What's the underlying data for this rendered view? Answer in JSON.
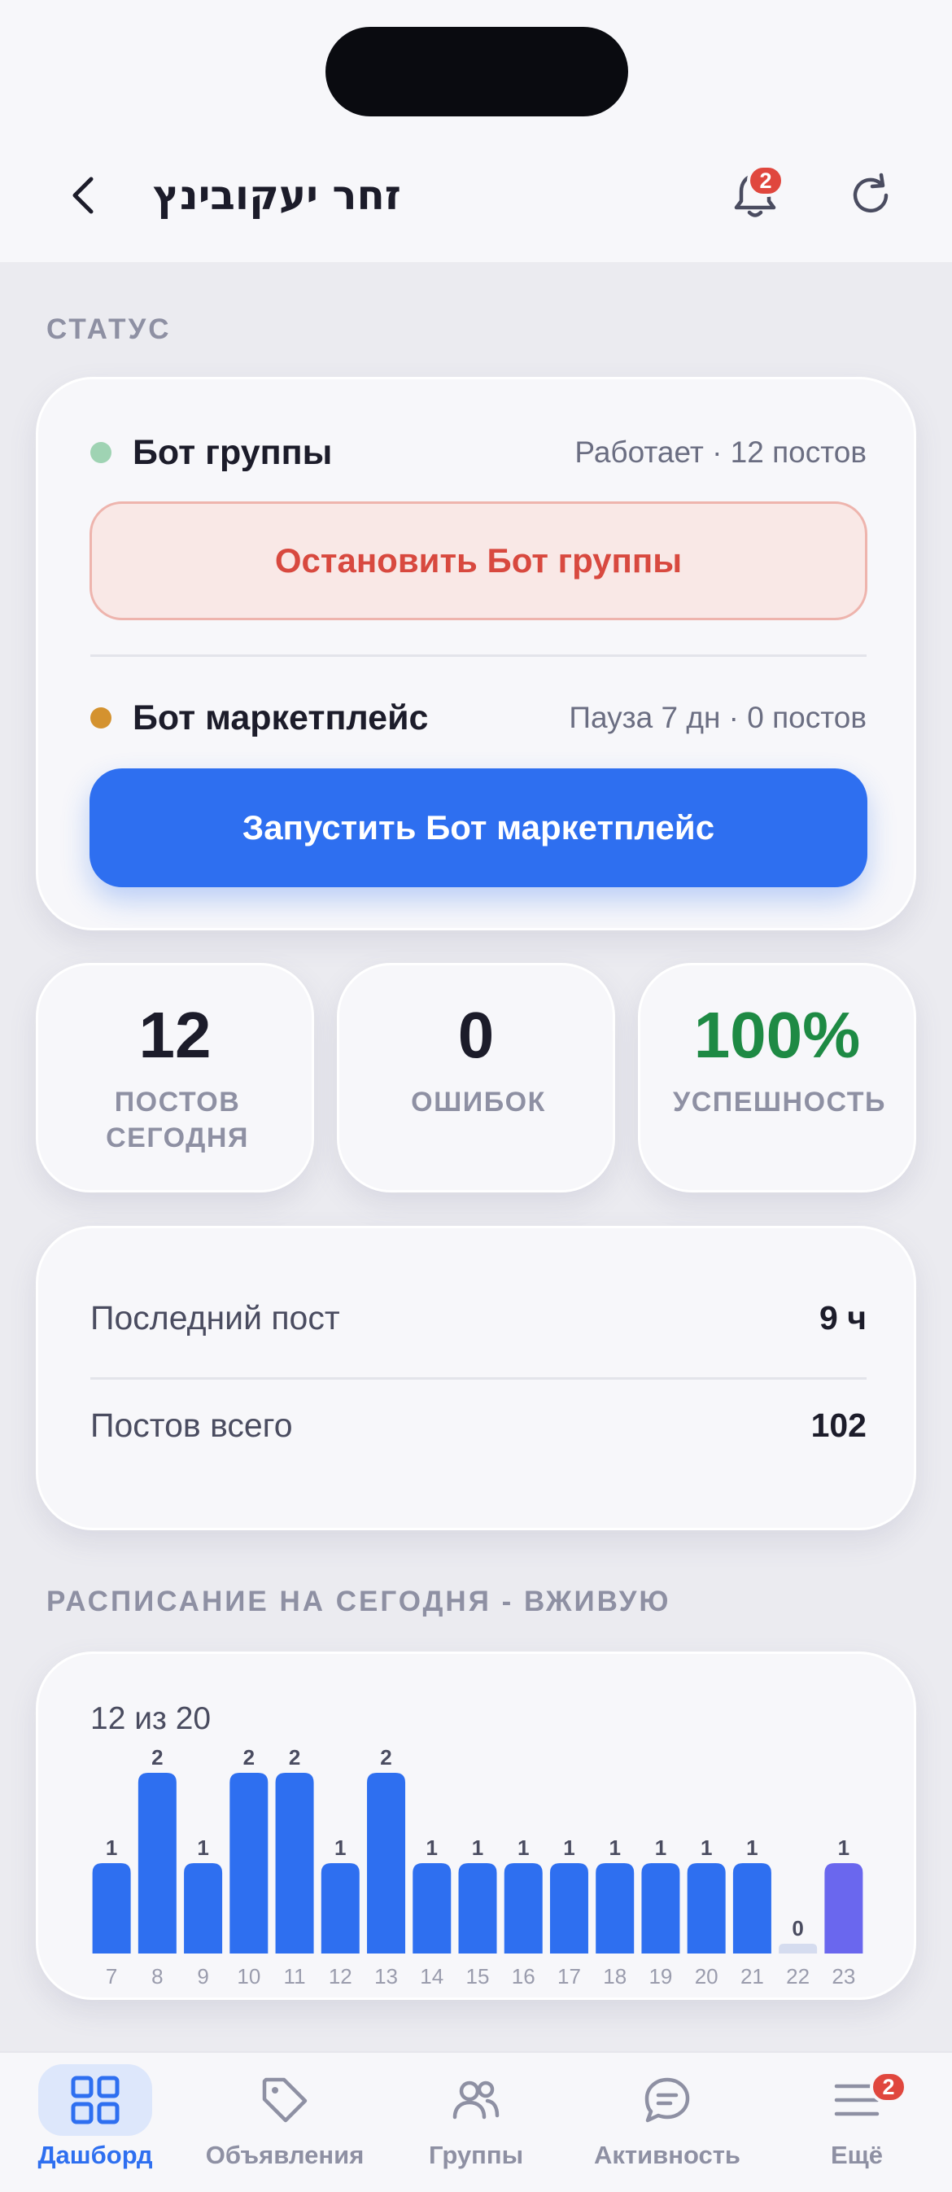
{
  "header": {
    "title": "זחר יעקובינץ",
    "notification_count": "2"
  },
  "status_section": {
    "label": "СТАТУС",
    "bots": [
      {
        "name": "Бот группы",
        "info": "Работает · 12 постов",
        "dot_color": "#9fd3b3",
        "action_label": "Остановить Бот группы"
      },
      {
        "name": "Бот маркетплейс",
        "info": "Пауза 7 дн · 0 постов",
        "dot_color": "#d4922f",
        "action_label": "Запустить Бот маркетплейс"
      }
    ]
  },
  "stats": [
    {
      "value": "12",
      "label": "ПОСТОВ СЕГОДНЯ",
      "color": "#1c1c2a"
    },
    {
      "value": "0",
      "label": "ОШИБОК",
      "color": "#1c1c2a"
    },
    {
      "value": "100%",
      "label": "УСПЕШНОСТЬ",
      "color": "#1e8a44"
    }
  ],
  "info": [
    {
      "label": "Последний пост",
      "value": "9 ч"
    },
    {
      "label": "Постов всего",
      "value": "102"
    }
  ],
  "schedule_section": {
    "label": "РАСПИСАНИЕ НА СЕГОДНЯ - ВЖИВУЮ",
    "count_text": "12 из 20"
  },
  "chart_data": {
    "type": "bar",
    "title": "",
    "xlabel": "",
    "ylabel": "",
    "categories": [
      "7",
      "8",
      "9",
      "10",
      "11",
      "12",
      "13",
      "14",
      "15",
      "16",
      "17",
      "18",
      "19",
      "20",
      "21",
      "22",
      "23"
    ],
    "values": [
      1,
      2,
      1,
      2,
      2,
      1,
      2,
      1,
      1,
      1,
      1,
      1,
      1,
      1,
      1,
      0,
      1
    ],
    "ylim": [
      0,
      2
    ],
    "current_hour": "23",
    "colors": {
      "bar": "#2e6ff0",
      "current": "#6a67ee",
      "empty": "#d5dcef"
    }
  },
  "tabbar": {
    "tabs": [
      {
        "label": "Дашборд",
        "icon": "grid-icon",
        "active": true
      },
      {
        "label": "Объявления",
        "icon": "tag-icon",
        "active": false
      },
      {
        "label": "Группы",
        "icon": "users-icon",
        "active": false
      },
      {
        "label": "Активность",
        "icon": "chat-icon",
        "active": false
      },
      {
        "label": "Ещё",
        "icon": "menu-icon",
        "active": false,
        "badge": "2"
      }
    ]
  },
  "colors": {
    "accent": "#2e6ff0",
    "danger": "#d8493f",
    "success": "#1e8a44",
    "badge": "#e0473e"
  }
}
